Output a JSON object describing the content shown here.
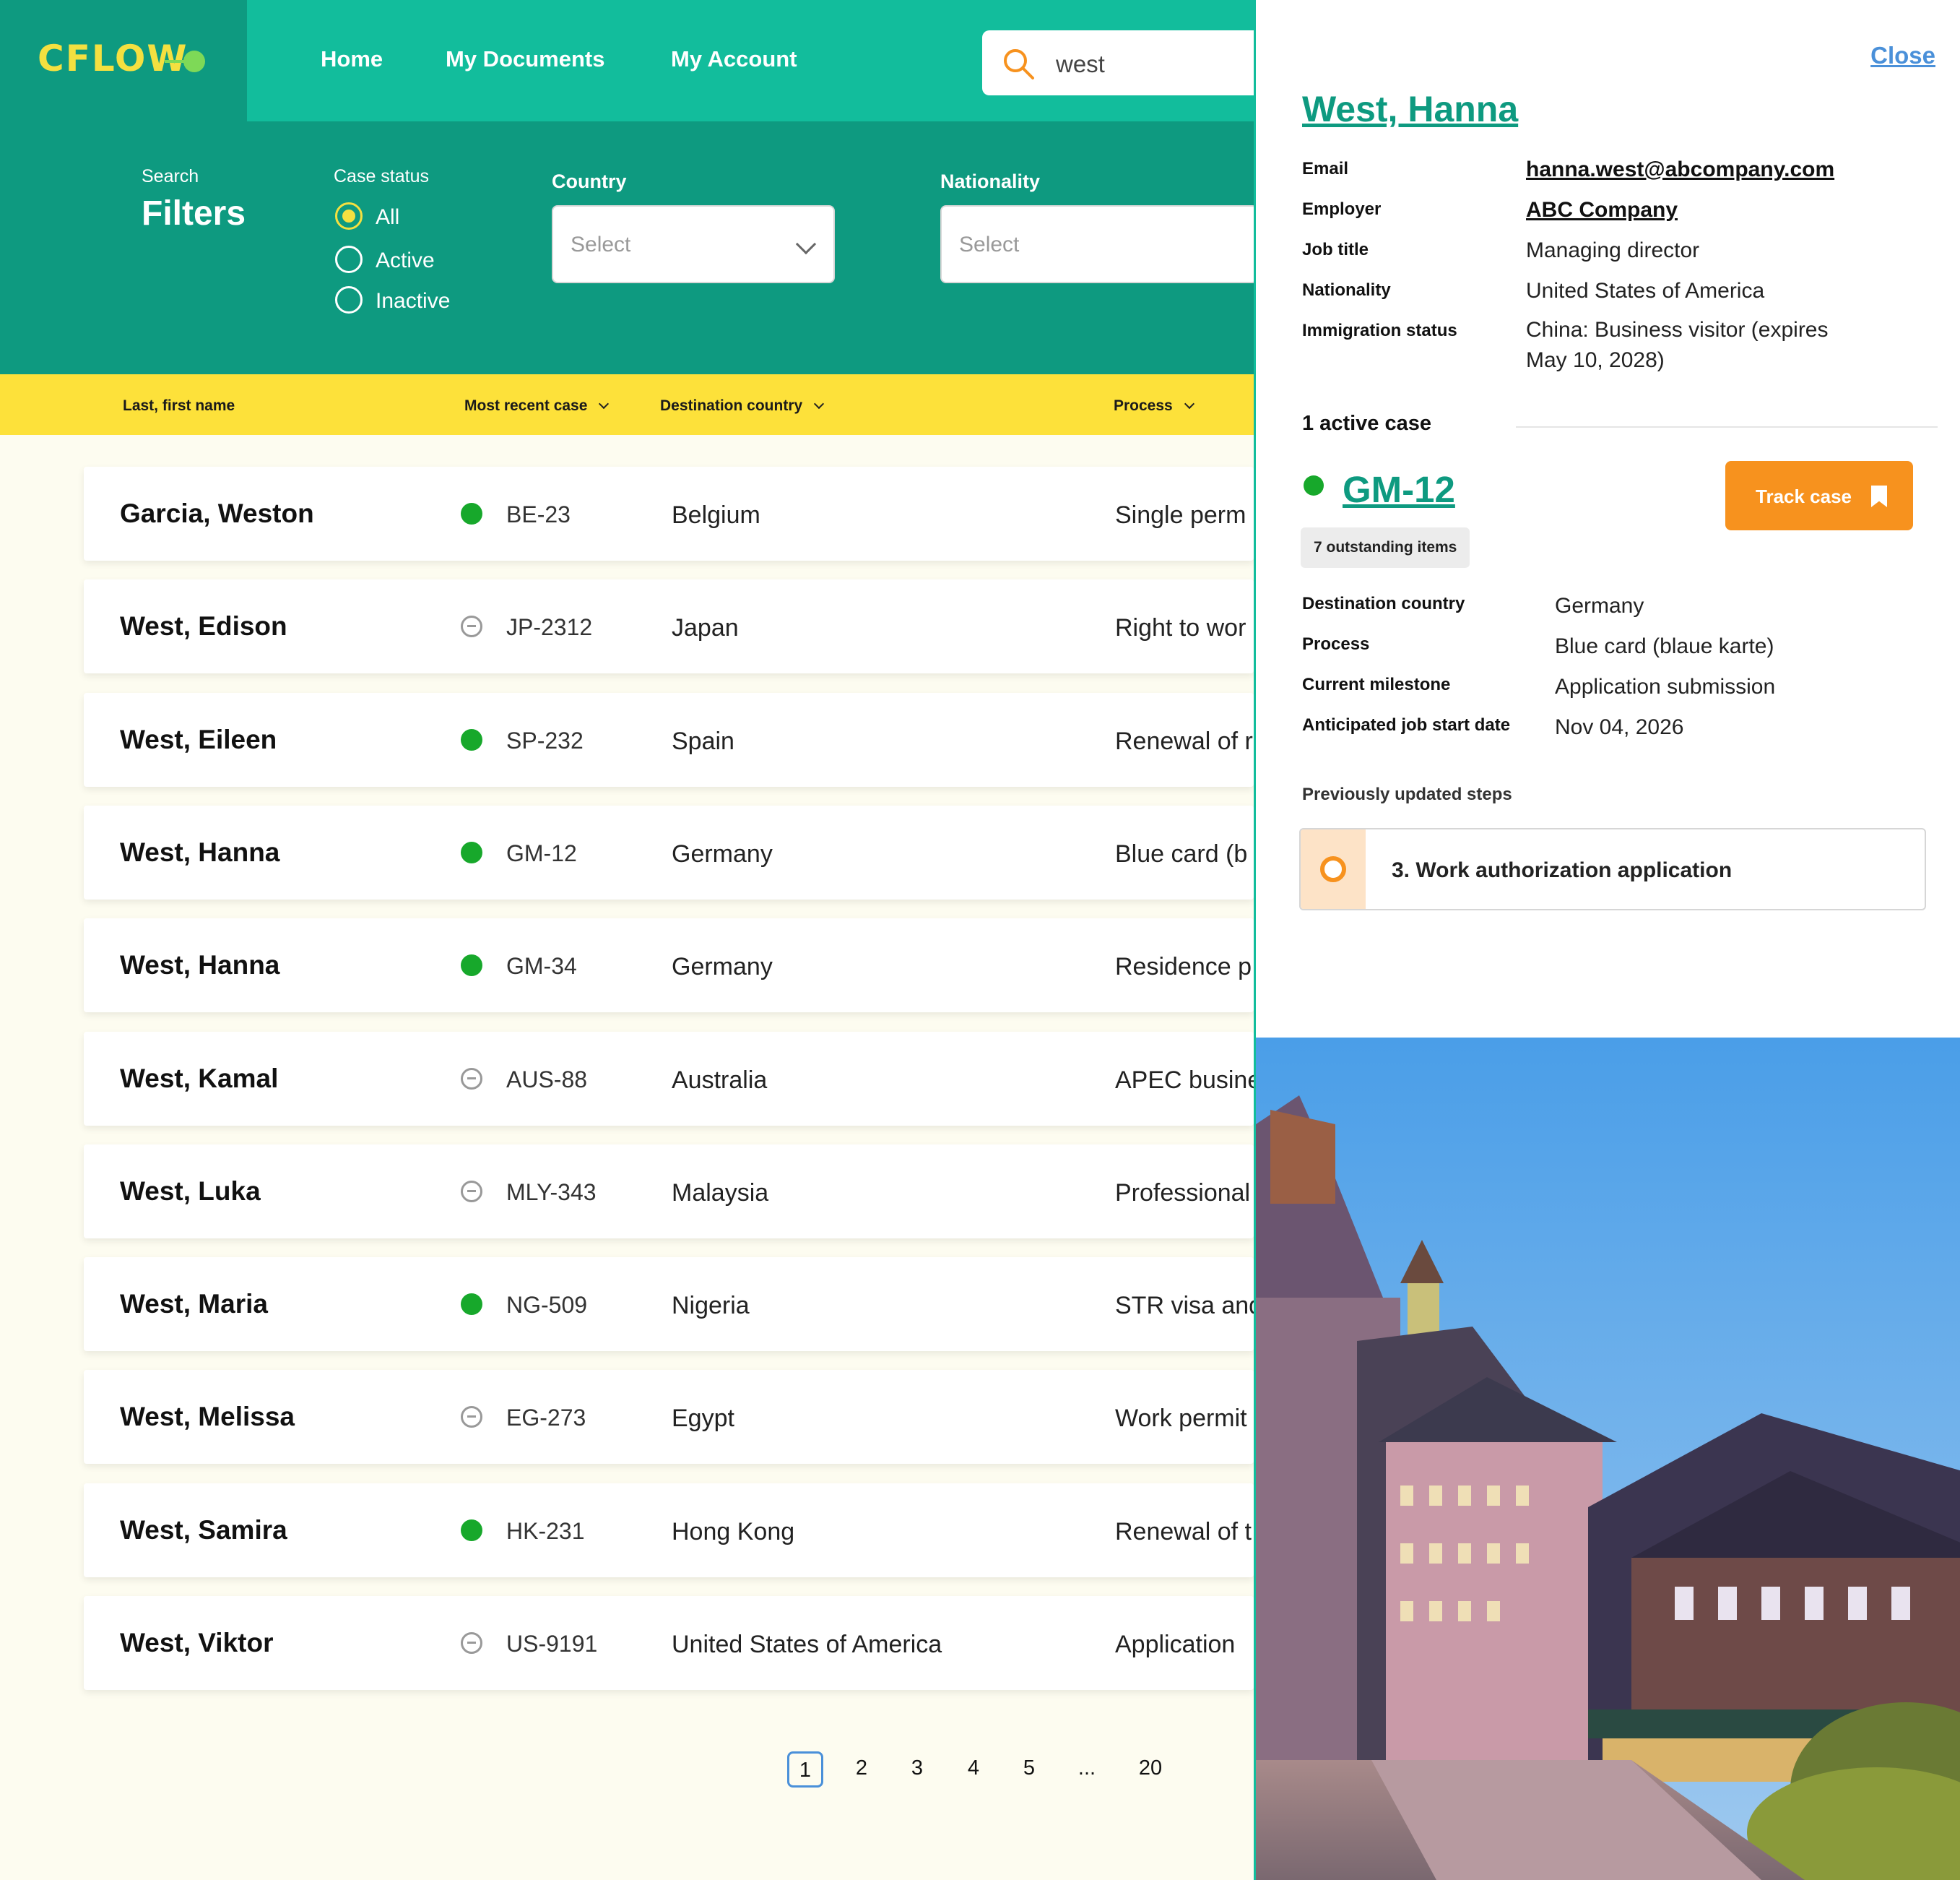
{
  "header": {
    "logo": "CFLOW",
    "nav": [
      "Home",
      "My Documents",
      "My Account"
    ],
    "search_value": "west"
  },
  "filters": {
    "search_small": "Search",
    "title": "Filters",
    "case_status_label": "Case status",
    "status_options": [
      "All",
      "Active",
      "Inactive"
    ],
    "selected_status": "All",
    "country_label": "Country",
    "country_placeholder": "Select",
    "nationality_label": "Nationality",
    "nationality_placeholder": "Select"
  },
  "table": {
    "headers": [
      "Last, first name",
      "Most recent case",
      "Destination country",
      "Process"
    ],
    "rows": [
      {
        "name": "Garcia, Weston",
        "status": "active",
        "case": "BE-23",
        "country": "Belgium",
        "process": "Single perm"
      },
      {
        "name": "West, Edison",
        "status": "inactive",
        "case": "JP-2312",
        "country": "Japan",
        "process": "Right to wor"
      },
      {
        "name": "West, Eileen",
        "status": "active",
        "case": "SP-232",
        "country": "Spain",
        "process": "Renewal of r"
      },
      {
        "name": "West, Hanna",
        "status": "active",
        "case": "GM-12",
        "country": "Germany",
        "process": "Blue card (b"
      },
      {
        "name": "West, Hanna",
        "status": "active",
        "case": "GM-34",
        "country": "Germany",
        "process": "Residence p"
      },
      {
        "name": "West, Kamal",
        "status": "inactive",
        "case": "AUS-88",
        "country": "Australia",
        "process": "APEC busine"
      },
      {
        "name": "West, Luka",
        "status": "inactive",
        "case": "MLY-343",
        "country": "Malaysia",
        "process": "Professional"
      },
      {
        "name": "West, Maria",
        "status": "active",
        "case": "NG-509",
        "country": "Nigeria",
        "process": "STR visa and"
      },
      {
        "name": "West, Melissa",
        "status": "inactive",
        "case": "EG-273",
        "country": "Egypt",
        "process": "Work permit"
      },
      {
        "name": "West, Samira",
        "status": "active",
        "case": "HK-231",
        "country": "Hong Kong",
        "process": "Renewal of t"
      },
      {
        "name": "West, Viktor",
        "status": "inactive",
        "case": "US-9191",
        "country": "United States of America",
        "process": "Application"
      }
    ]
  },
  "pagination": [
    "1",
    "2",
    "3",
    "4",
    "5",
    "...",
    "20"
  ],
  "current_page": "1",
  "panel": {
    "close": "Close",
    "name": "West, Hanna",
    "fields": [
      {
        "label": "Email",
        "value": "hanna.west@abcompany.com",
        "link": true
      },
      {
        "label": "Employer",
        "value": "ABC Company",
        "link": true
      },
      {
        "label": "Job title",
        "value": "Managing director"
      },
      {
        "label": "Nationality",
        "value": "United States of America"
      },
      {
        "label": "Immigration status",
        "value": "China: Business visitor (expires",
        "value2": "May 10, 2028)"
      }
    ],
    "active_cases": "1 active case",
    "case_id": "GM-12",
    "track_label": "Track case",
    "outstanding": "7 outstanding items",
    "case_fields": [
      {
        "label": "Destination country",
        "value": "Germany"
      },
      {
        "label": "Process",
        "value": "Blue card (blaue karte)"
      },
      {
        "label": "Current milestone",
        "value": "Application submission"
      },
      {
        "label": "Anticipated job start date",
        "value": "Nov 04, 2026"
      }
    ],
    "prev_label": "Previously updated steps",
    "step": "3. Work authorization application"
  },
  "colors": {
    "header_green": "#12bd9c",
    "dark_green": "#0e9a80",
    "yellow": "#fde13a",
    "orange": "#f7921e",
    "active_dot": "#17a82b"
  }
}
